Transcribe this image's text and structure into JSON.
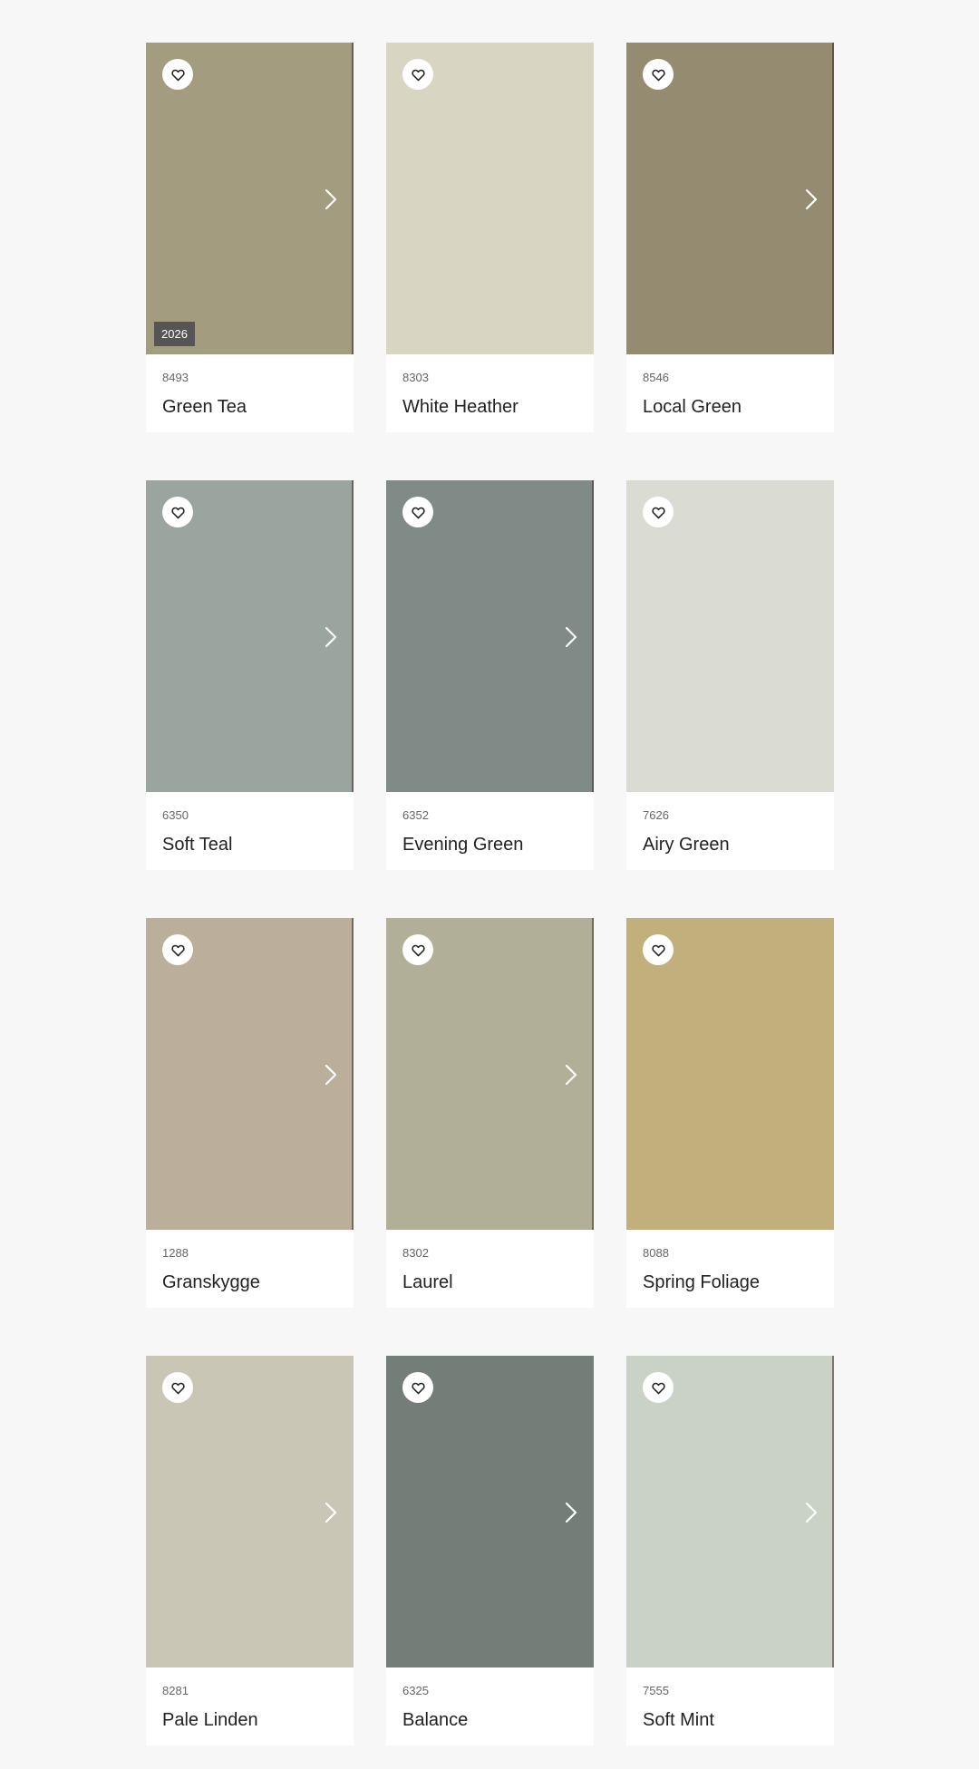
{
  "colors": [
    {
      "code": "8493",
      "name": "Green Tea",
      "swatch": "#a39c7e",
      "badge": "2026",
      "has_next": true,
      "edge": true
    },
    {
      "code": "8303",
      "name": "White Heather",
      "swatch": "#d8d5c2",
      "badge": "",
      "has_next": false,
      "edge": false
    },
    {
      "code": "8546",
      "name": "Local Green",
      "swatch": "#958b70",
      "badge": "",
      "has_next": true,
      "edge": true
    },
    {
      "code": "6350",
      "name": "Soft Teal",
      "swatch": "#9ba59f",
      "badge": "",
      "has_next": true,
      "edge": true
    },
    {
      "code": "6352",
      "name": "Evening Green",
      "swatch": "#808a86",
      "badge": "",
      "has_next": true,
      "edge": true
    },
    {
      "code": "7626",
      "name": "Airy Green",
      "swatch": "#dadcd3",
      "badge": "",
      "has_next": false,
      "edge": false
    },
    {
      "code": "1288",
      "name": "Granskygge",
      "swatch": "#bbaf9b",
      "badge": "",
      "has_next": true,
      "edge": true
    },
    {
      "code": "8302",
      "name": "Laurel",
      "swatch": "#b1af98",
      "badge": "",
      "has_next": true,
      "edge": true
    },
    {
      "code": "8088",
      "name": "Spring Foliage",
      "swatch": "#c1b07c",
      "badge": "",
      "has_next": false,
      "edge": false
    },
    {
      "code": "8281",
      "name": "Pale Linden",
      "swatch": "#c9c6b5",
      "badge": "",
      "has_next": true,
      "edge": false
    },
    {
      "code": "6325",
      "name": "Balance",
      "swatch": "#737e79",
      "badge": "",
      "has_next": true,
      "edge": false
    },
    {
      "code": "7555",
      "name": "Soft Mint",
      "swatch": "#cad2c7",
      "badge": "",
      "has_next": true,
      "edge": true
    }
  ],
  "icons": {
    "favorite": "heart-outline-icon",
    "next": "chevron-right-icon"
  },
  "theme": {
    "page_background": "#f7f7f7",
    "card_background": "#ffffff",
    "badge_background": "#555555"
  }
}
